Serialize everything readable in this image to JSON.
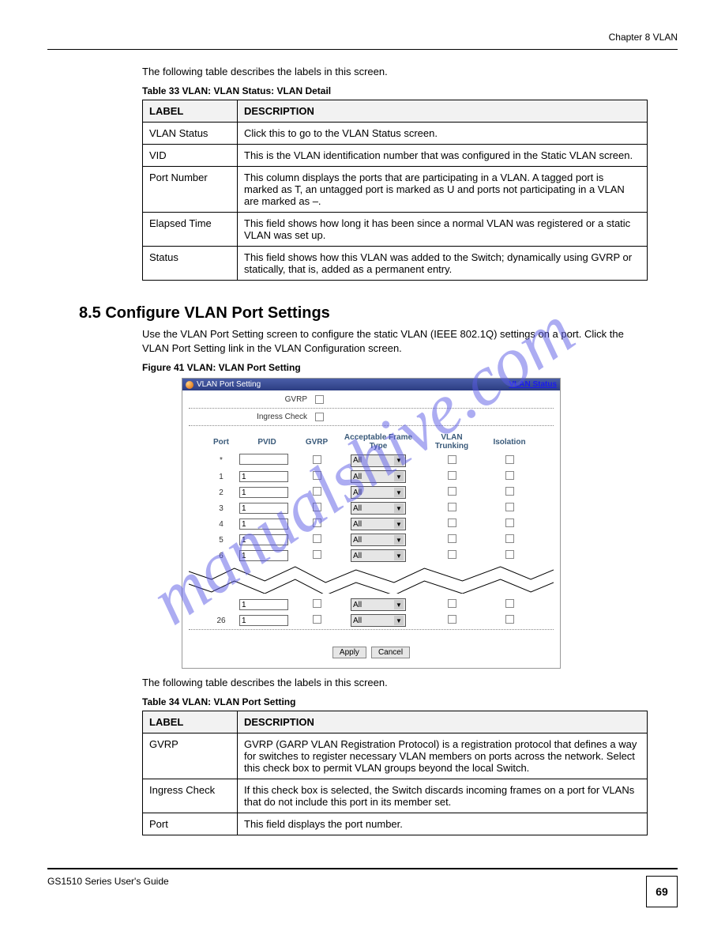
{
  "header": {
    "right": "Chapter 8 VLAN"
  },
  "intro_text": "The following table describes the labels in this screen.",
  "table33": {
    "caption": "Table 33   VLAN: VLAN Status: VLAN Detail",
    "headers": [
      "LABEL",
      "DESCRIPTION"
    ],
    "rows": [
      {
        "label": "VLAN Status",
        "desc": "Click this to go to the VLAN Status screen."
      },
      {
        "label": "VID",
        "desc": "This is the VLAN identification number that was configured in the Static VLAN screen."
      },
      {
        "label": "Port Number",
        "desc": "This column displays the ports that are participating in a VLAN. A tagged port is marked as T, an untagged port is marked as U and ports not participating in a VLAN are marked as –."
      },
      {
        "label": "Elapsed Time",
        "desc": "This field shows how long it has been since a normal VLAN was registered or a static VLAN was set up."
      },
      {
        "label": "Status",
        "desc": "This field shows how this VLAN was added to the Switch; dynamically using GVRP or statically, that is, added as a permanent entry."
      }
    ]
  },
  "section": {
    "heading": "8.5  Configure VLAN Port Settings",
    "para": "Use the VLAN Port Setting screen to configure the static VLAN (IEEE 802.1Q) settings on a port. Click the VLAN Port Setting link in the VLAN Configuration screen."
  },
  "figure": {
    "caption": "Figure 41   VLAN: VLAN Port Setting",
    "titlebar": "VLAN Port Setting",
    "status_link": "VLAN Status",
    "top_rows": [
      {
        "label": "GVRP"
      },
      {
        "label": "Ingress Check"
      }
    ],
    "columns": [
      "Port",
      "PVID",
      "GVRP",
      "Acceptable Frame Type",
      "VLAN Trunking",
      "Isolation"
    ],
    "rows_top": [
      {
        "port": "*",
        "pvid": "",
        "aft": "All"
      },
      {
        "port": "1",
        "pvid": "1",
        "aft": "All"
      },
      {
        "port": "2",
        "pvid": "1",
        "aft": "All"
      },
      {
        "port": "3",
        "pvid": "1",
        "aft": "All"
      },
      {
        "port": "4",
        "pvid": "1",
        "aft": "All"
      },
      {
        "port": "5",
        "pvid": "1",
        "aft": "All"
      },
      {
        "port": "6",
        "pvid": "1",
        "aft": "All"
      }
    ],
    "rows_bottom": [
      {
        "port": "",
        "pvid": "1",
        "aft": "All"
      },
      {
        "port": "26",
        "pvid": "1",
        "aft": "All"
      }
    ],
    "buttons": {
      "apply": "Apply",
      "cancel": "Cancel"
    }
  },
  "post_fig_text": "The following table describes the labels in this screen.",
  "table34": {
    "caption": "Table 34   VLAN: VLAN Port Setting",
    "headers": [
      "LABEL",
      "DESCRIPTION"
    ],
    "rows": [
      {
        "label": "GVRP",
        "desc": "GVRP (GARP VLAN Registration Protocol) is a registration protocol that defines a way for switches to register necessary VLAN members on ports across the network. Select this check box to permit VLAN groups beyond the local Switch."
      },
      {
        "label": "Ingress Check",
        "desc": "If this check box is selected, the Switch discards incoming frames on a port for VLANs that do not include this port in its member set."
      },
      {
        "label": "Port",
        "desc": "This field displays the port number."
      }
    ]
  },
  "footer": {
    "left": "GS1510 Series User's Guide",
    "page": "69"
  },
  "watermark": "manualshive.com"
}
